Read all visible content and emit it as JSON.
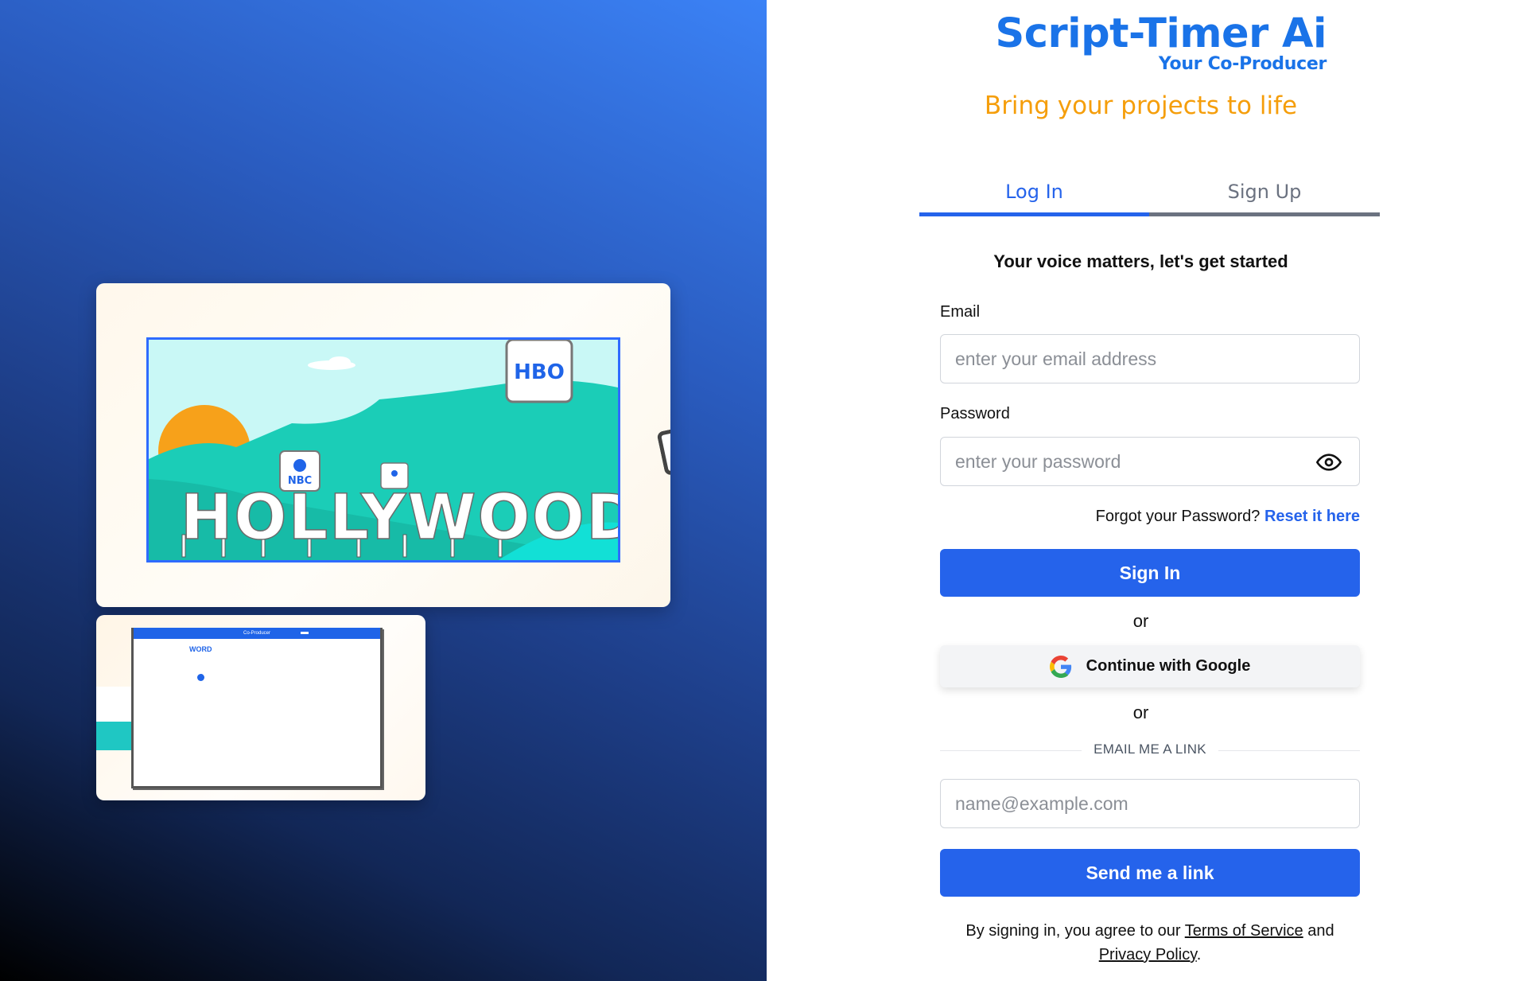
{
  "brand": {
    "title": "Script-Timer Ai",
    "subtitle": "Your Co-Producer",
    "tagline": "Bring your projects to life"
  },
  "tabs": [
    {
      "label": "Log In",
      "active": true
    },
    {
      "label": "Sign Up",
      "active": false
    }
  ],
  "form": {
    "headline": "Your voice matters, let's get started",
    "email_label": "Email",
    "email_placeholder": "enter your email address",
    "email_value": "",
    "password_label": "Password",
    "password_placeholder": "enter your password",
    "password_value": "",
    "forgot_text": "Forgot your Password?",
    "reset_link": "Reset it here",
    "signin_label": "Sign In",
    "or_1": "or",
    "google_label": "Continue with Google",
    "or_2": "or",
    "magic_divider": "EMAIL ME A LINK",
    "magic_placeholder": "name@example.com",
    "magic_value": "",
    "send_link_label": "Send me a link"
  },
  "legal": {
    "prefix": "By signing in, you agree to our",
    "terms": "Terms of Service",
    "and": "and",
    "privacy": "Privacy Policy",
    "suffix": "."
  },
  "preview": {
    "scene_text": "HOLLYWOOD",
    "badges": [
      "HBO",
      "NBC"
    ],
    "mini_window_title": "Co-Producer",
    "mini_window_word": "WORD"
  },
  "colors": {
    "brand_blue": "#1a73e8",
    "primary_button": "#2563eb",
    "tagline_orange": "#f59e0b",
    "inactive_tab": "#6b7280"
  }
}
